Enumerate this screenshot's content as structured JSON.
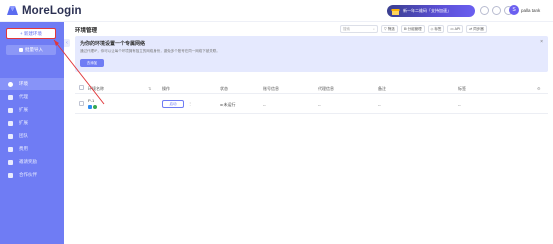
{
  "brand": {
    "name": "MoreLogin"
  },
  "promo": {
    "text": "新一年二维码「支持加速」"
  },
  "user": {
    "avatar_text": "S",
    "name": "palla tank"
  },
  "sidebar": {
    "new_button": "+ 新建环境",
    "import_button": "批量导入",
    "items": [
      {
        "label": "环境"
      },
      {
        "label": "代理"
      },
      {
        "label": "扩展"
      },
      {
        "label": "扩展"
      },
      {
        "label": "团队"
      },
      {
        "label": "费用"
      },
      {
        "label": "邀请奖励"
      },
      {
        "label": "合作伙伴"
      }
    ]
  },
  "main": {
    "title": "环境管理",
    "toolbar": {
      "search_placeholder": "搜索",
      "buttons": [
        "筛选",
        "分组管理",
        "标签",
        "API",
        "同步器"
      ]
    },
    "banner": {
      "title": "为你的环境设置一个专属网络",
      "desc": "通过代理IP，你可以让每个环境拥有独立的网络身份，避免多个账号在同一网络下被关联。",
      "button": "去添加",
      "close": "×"
    },
    "table": {
      "headers": [
        "环境名称",
        "操作",
        "状态",
        "账号信息",
        "代理信息",
        "备注",
        "标签"
      ],
      "rows": [
        {
          "name": "P-1",
          "id": "#1",
          "action": "启动",
          "status": "未运行",
          "account": "--",
          "proxy": "--",
          "note": "--",
          "tag": "--"
        }
      ]
    }
  },
  "colors": {
    "accent": "#6f7cf4",
    "sidebar": "#6f7cf4",
    "highlight": "#e2373a"
  }
}
